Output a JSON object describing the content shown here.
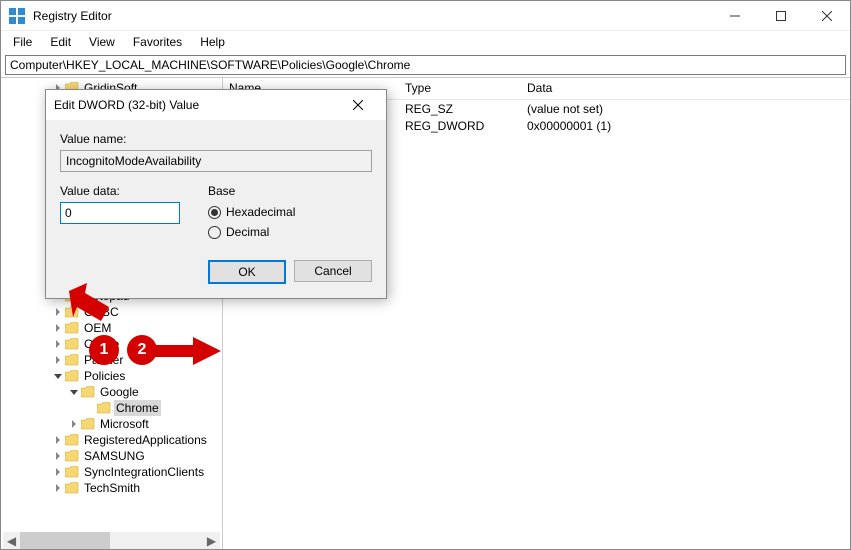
{
  "app": {
    "title": "Registry Editor"
  },
  "menu": {
    "file": "File",
    "edit": "Edit",
    "view": "View",
    "favorites": "Favorites",
    "help": "Help"
  },
  "address": "Computer\\HKEY_LOCAL_MACHINE\\SOFTWARE\\Policies\\Google\\Chrome",
  "tree": {
    "items": [
      {
        "indent": 48,
        "exp": "right",
        "label": "GridinSoft",
        "sel": false
      },
      {
        "indent": 48,
        "exp": "none",
        "label": "Notepad++",
        "sel": false
      },
      {
        "indent": 48,
        "exp": "right",
        "label": "ODBC",
        "sel": false
      },
      {
        "indent": 48,
        "exp": "right",
        "label": "OEM",
        "sel": false
      },
      {
        "indent": 48,
        "exp": "right",
        "label": "Oracle",
        "sel": false
      },
      {
        "indent": 48,
        "exp": "right",
        "label": "Partner",
        "sel": false
      },
      {
        "indent": 48,
        "exp": "down",
        "label": "Policies",
        "sel": false
      },
      {
        "indent": 64,
        "exp": "down",
        "label": "Google",
        "sel": false
      },
      {
        "indent": 80,
        "exp": "none",
        "label": "Chrome",
        "sel": true
      },
      {
        "indent": 64,
        "exp": "right",
        "label": "Microsoft",
        "sel": false
      },
      {
        "indent": 48,
        "exp": "right",
        "label": "RegisteredApplications",
        "sel": false
      },
      {
        "indent": 48,
        "exp": "right",
        "label": "SAMSUNG",
        "sel": false
      },
      {
        "indent": 48,
        "exp": "right",
        "label": "SyncIntegrationClients",
        "sel": false
      },
      {
        "indent": 48,
        "exp": "right",
        "label": "TechSmith",
        "sel": false
      }
    ]
  },
  "list": {
    "headers": {
      "name": "Name",
      "type": "Type",
      "data": "Data"
    },
    "rows": [
      {
        "name": "",
        "type": "REG_SZ",
        "data": "(value not set)"
      },
      {
        "name": "",
        "type": "REG_DWORD",
        "data": "0x00000001 (1)"
      }
    ]
  },
  "dialog": {
    "title": "Edit DWORD (32-bit) Value",
    "value_name_label": "Value name:",
    "value_name": "IncognitoModeAvailability",
    "value_data_label": "Value data:",
    "value_data": "0",
    "base_label": "Base",
    "hex_label": "Hexadecimal",
    "dec_label": "Decimal",
    "ok": "OK",
    "cancel": "Cancel"
  },
  "annotations": {
    "step1": "1",
    "step2": "2"
  }
}
